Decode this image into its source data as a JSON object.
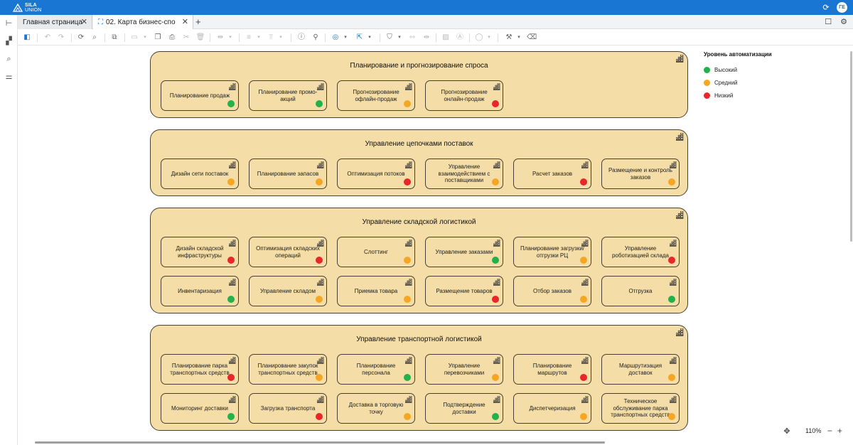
{
  "app": {
    "brand_top": "SILA",
    "brand_bottom": "UNION",
    "user_initials": "ГЕ"
  },
  "tabs": [
    {
      "label": "Главная страница"
    },
    {
      "label": "02. Карта бизнес-спо"
    }
  ],
  "legend": {
    "title": "Уровень автоматизации",
    "items": [
      {
        "label": "Высокий",
        "color": "#22b14c"
      },
      {
        "label": "Средний",
        "color": "#f5a623"
      },
      {
        "label": "Низкий",
        "color": "#e8262b"
      }
    ]
  },
  "colors": {
    "high": "#22b14c",
    "medium": "#f5a623",
    "low": "#e8262b",
    "block_fill": "#f4dda6",
    "accent": "#1976d2"
  },
  "groups": [
    {
      "title": "Планирование и прогнозирование спроса",
      "items": [
        {
          "label": "Планирование продаж",
          "level": "high"
        },
        {
          "label": "Планирование промо-акций",
          "level": "high"
        },
        {
          "label": "Прогнозирование офлайн-продаж",
          "level": "medium"
        },
        {
          "label": "Прогнозирование онлайн-продаж",
          "level": "low"
        }
      ]
    },
    {
      "title": "Управление цепочками поставок",
      "items": [
        {
          "label": "Дизайн сети поставок",
          "level": "medium"
        },
        {
          "label": "Планирование запасов",
          "level": "medium"
        },
        {
          "label": "Оптимизация потоков",
          "level": "low"
        },
        {
          "label": "Управление взаимодействием с поставщиками",
          "level": "medium"
        },
        {
          "label": "Расчет заказов",
          "level": "low"
        },
        {
          "label": "Размещение и контроль заказов",
          "level": "medium"
        }
      ]
    },
    {
      "title": "Управление складской логистикой",
      "items": [
        {
          "label": "Дизайн складской инфраструктуры",
          "level": "low"
        },
        {
          "label": "Оптимизация складских операций",
          "level": "low"
        },
        {
          "label": "Слоттинг",
          "level": "medium"
        },
        {
          "label": "Управление заказами",
          "level": "high"
        },
        {
          "label": "Планирование загрузки/отгрузки РЦ",
          "level": "medium"
        },
        {
          "label": "Управление роботизацией склада",
          "level": "low"
        },
        {
          "label": "Инвентаризация",
          "level": "high"
        },
        {
          "label": "Управление складом",
          "level": "medium"
        },
        {
          "label": "Приемка товара",
          "level": "medium"
        },
        {
          "label": "Размещение товаров",
          "level": "low"
        },
        {
          "label": "Отбор заказов",
          "level": "medium"
        },
        {
          "label": "Отгрузка",
          "level": "high"
        }
      ]
    },
    {
      "title": "Управление транспортной логистикой",
      "items": [
        {
          "label": "Планирование парка транспортных средств",
          "level": "low"
        },
        {
          "label": "Планирование закупок транспортных средств",
          "level": "medium"
        },
        {
          "label": "Планирование персонала",
          "level": "high"
        },
        {
          "label": "Управление перевозчиками",
          "level": "medium"
        },
        {
          "label": "Планирование маршрутов",
          "level": "low"
        },
        {
          "label": "Маршрутизация доставок",
          "level": "medium"
        },
        {
          "label": "Мониторинг доставки",
          "level": "high"
        },
        {
          "label": "Загрузка транспорта",
          "level": "low"
        },
        {
          "label": "Доставка в торговую точку",
          "level": "medium"
        },
        {
          "label": "Подтверждение доставки",
          "level": "high"
        },
        {
          "label": "Диспетчеризация",
          "level": "medium"
        },
        {
          "label": "Техническое обслуживание парка транспортных средств",
          "level": "medium"
        }
      ]
    }
  ],
  "zoom": {
    "value": "110%"
  }
}
